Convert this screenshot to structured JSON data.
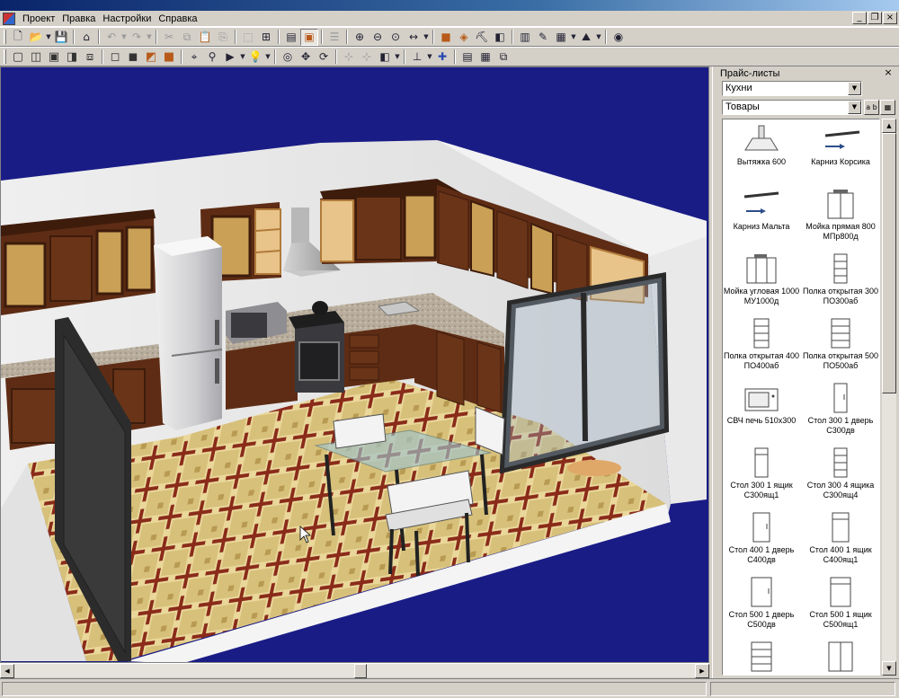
{
  "menu": {
    "items": [
      "Проект",
      "Правка",
      "Настройки",
      "Справка"
    ]
  },
  "window": {
    "minimize_glyph": "_",
    "restore_glyph": "❐",
    "close_glyph": "×"
  },
  "toolbar1": {
    "icons": [
      "new-document-icon",
      "open-folder-icon",
      "save-icon",
      "home-icon",
      "undo-icon",
      "redo-icon",
      "cut-icon",
      "copy-icon",
      "paste-icon",
      "select-icon",
      "transform-icon",
      "group-icon",
      "texture-icon",
      "properties-icon",
      "zoom-in-icon",
      "zoom-out-icon",
      "zoom-fit-icon",
      "dimension-icon",
      "box-front-icon",
      "box-texture-icon",
      "paint-icon",
      "material-icon",
      "table-icon",
      "edit-icon",
      "calendar-icon",
      "wall-icon",
      "palette-icon"
    ]
  },
  "toolbar2": {
    "icons": [
      "view-top-icon",
      "view-left-icon",
      "view-front-icon",
      "view-right-icon",
      "view-iso-icon",
      "cube-wire-icon",
      "cube-shaded-icon",
      "cube-textured-icon",
      "cube-wood-icon",
      "camera-icon",
      "walk-icon",
      "video-icon",
      "light-bulb-icon",
      "render-icon",
      "move-icon",
      "rotate-icon",
      "snap-icon",
      "align-icon",
      "mirror-icon",
      "distribute-icon",
      "insert-icon",
      "layers-icon",
      "print-icon",
      "export-icon"
    ]
  },
  "panel": {
    "title": "Прайс-листы",
    "close_glyph": "×",
    "catalog_select": "Кухни",
    "category_select": "Товары",
    "sort_button": "a b",
    "grid_button": "▦"
  },
  "catalog": {
    "items": [
      {
        "label": "Вытяжка 600",
        "icon": "hood-icon"
      },
      {
        "label": "Карниз Корсика",
        "icon": "cornice-icon"
      },
      {
        "label": "Карниз Мальта",
        "icon": "cornice-icon"
      },
      {
        "label": "Мойка прямая 800 МПр800д",
        "icon": "sink-cabinet-icon"
      },
      {
        "label": "Мойка угловая 1000 МУ1000д",
        "icon": "corner-sink-icon"
      },
      {
        "label": "Полка открытая 300 ПО300аб",
        "icon": "open-shelf-icon"
      },
      {
        "label": "Полка открытая 400 ПО400аб",
        "icon": "open-shelf-icon"
      },
      {
        "label": "Полка открытая 500 ПО500аб",
        "icon": "open-shelf-icon"
      },
      {
        "label": "СВЧ печь 510х300",
        "icon": "microwave-icon"
      },
      {
        "label": "Стол 300 1 дверь С300дв",
        "icon": "cabinet-door-icon"
      },
      {
        "label": "Стол 300 1 ящик С300ящ1",
        "icon": "cabinet-drawer-icon"
      },
      {
        "label": "Стол 300 4 ящика С300ящ4",
        "icon": "cabinet-drawers-icon"
      },
      {
        "label": "Стол 400 1 дверь С400дв",
        "icon": "cabinet-door-icon"
      },
      {
        "label": "Стол 400 1 ящик С400ящ1",
        "icon": "cabinet-drawer-icon"
      },
      {
        "label": "Стол 500 1 дверь С500дв",
        "icon": "cabinet-door-icon"
      },
      {
        "label": "Стол 500 1 ящик С500ящ1",
        "icon": "cabinet-drawer-icon"
      },
      {
        "label": "",
        "icon": "cabinet-drawers-icon"
      },
      {
        "label": "",
        "icon": "cabinet-door-icon"
      }
    ]
  },
  "colors": {
    "viewport_bg": "#1a1c86",
    "chrome": "#d4d0c8",
    "cabinet_wood": "#6a3418",
    "glass_frame": "#2a2a2a",
    "floor_base": "#cdb46a"
  }
}
